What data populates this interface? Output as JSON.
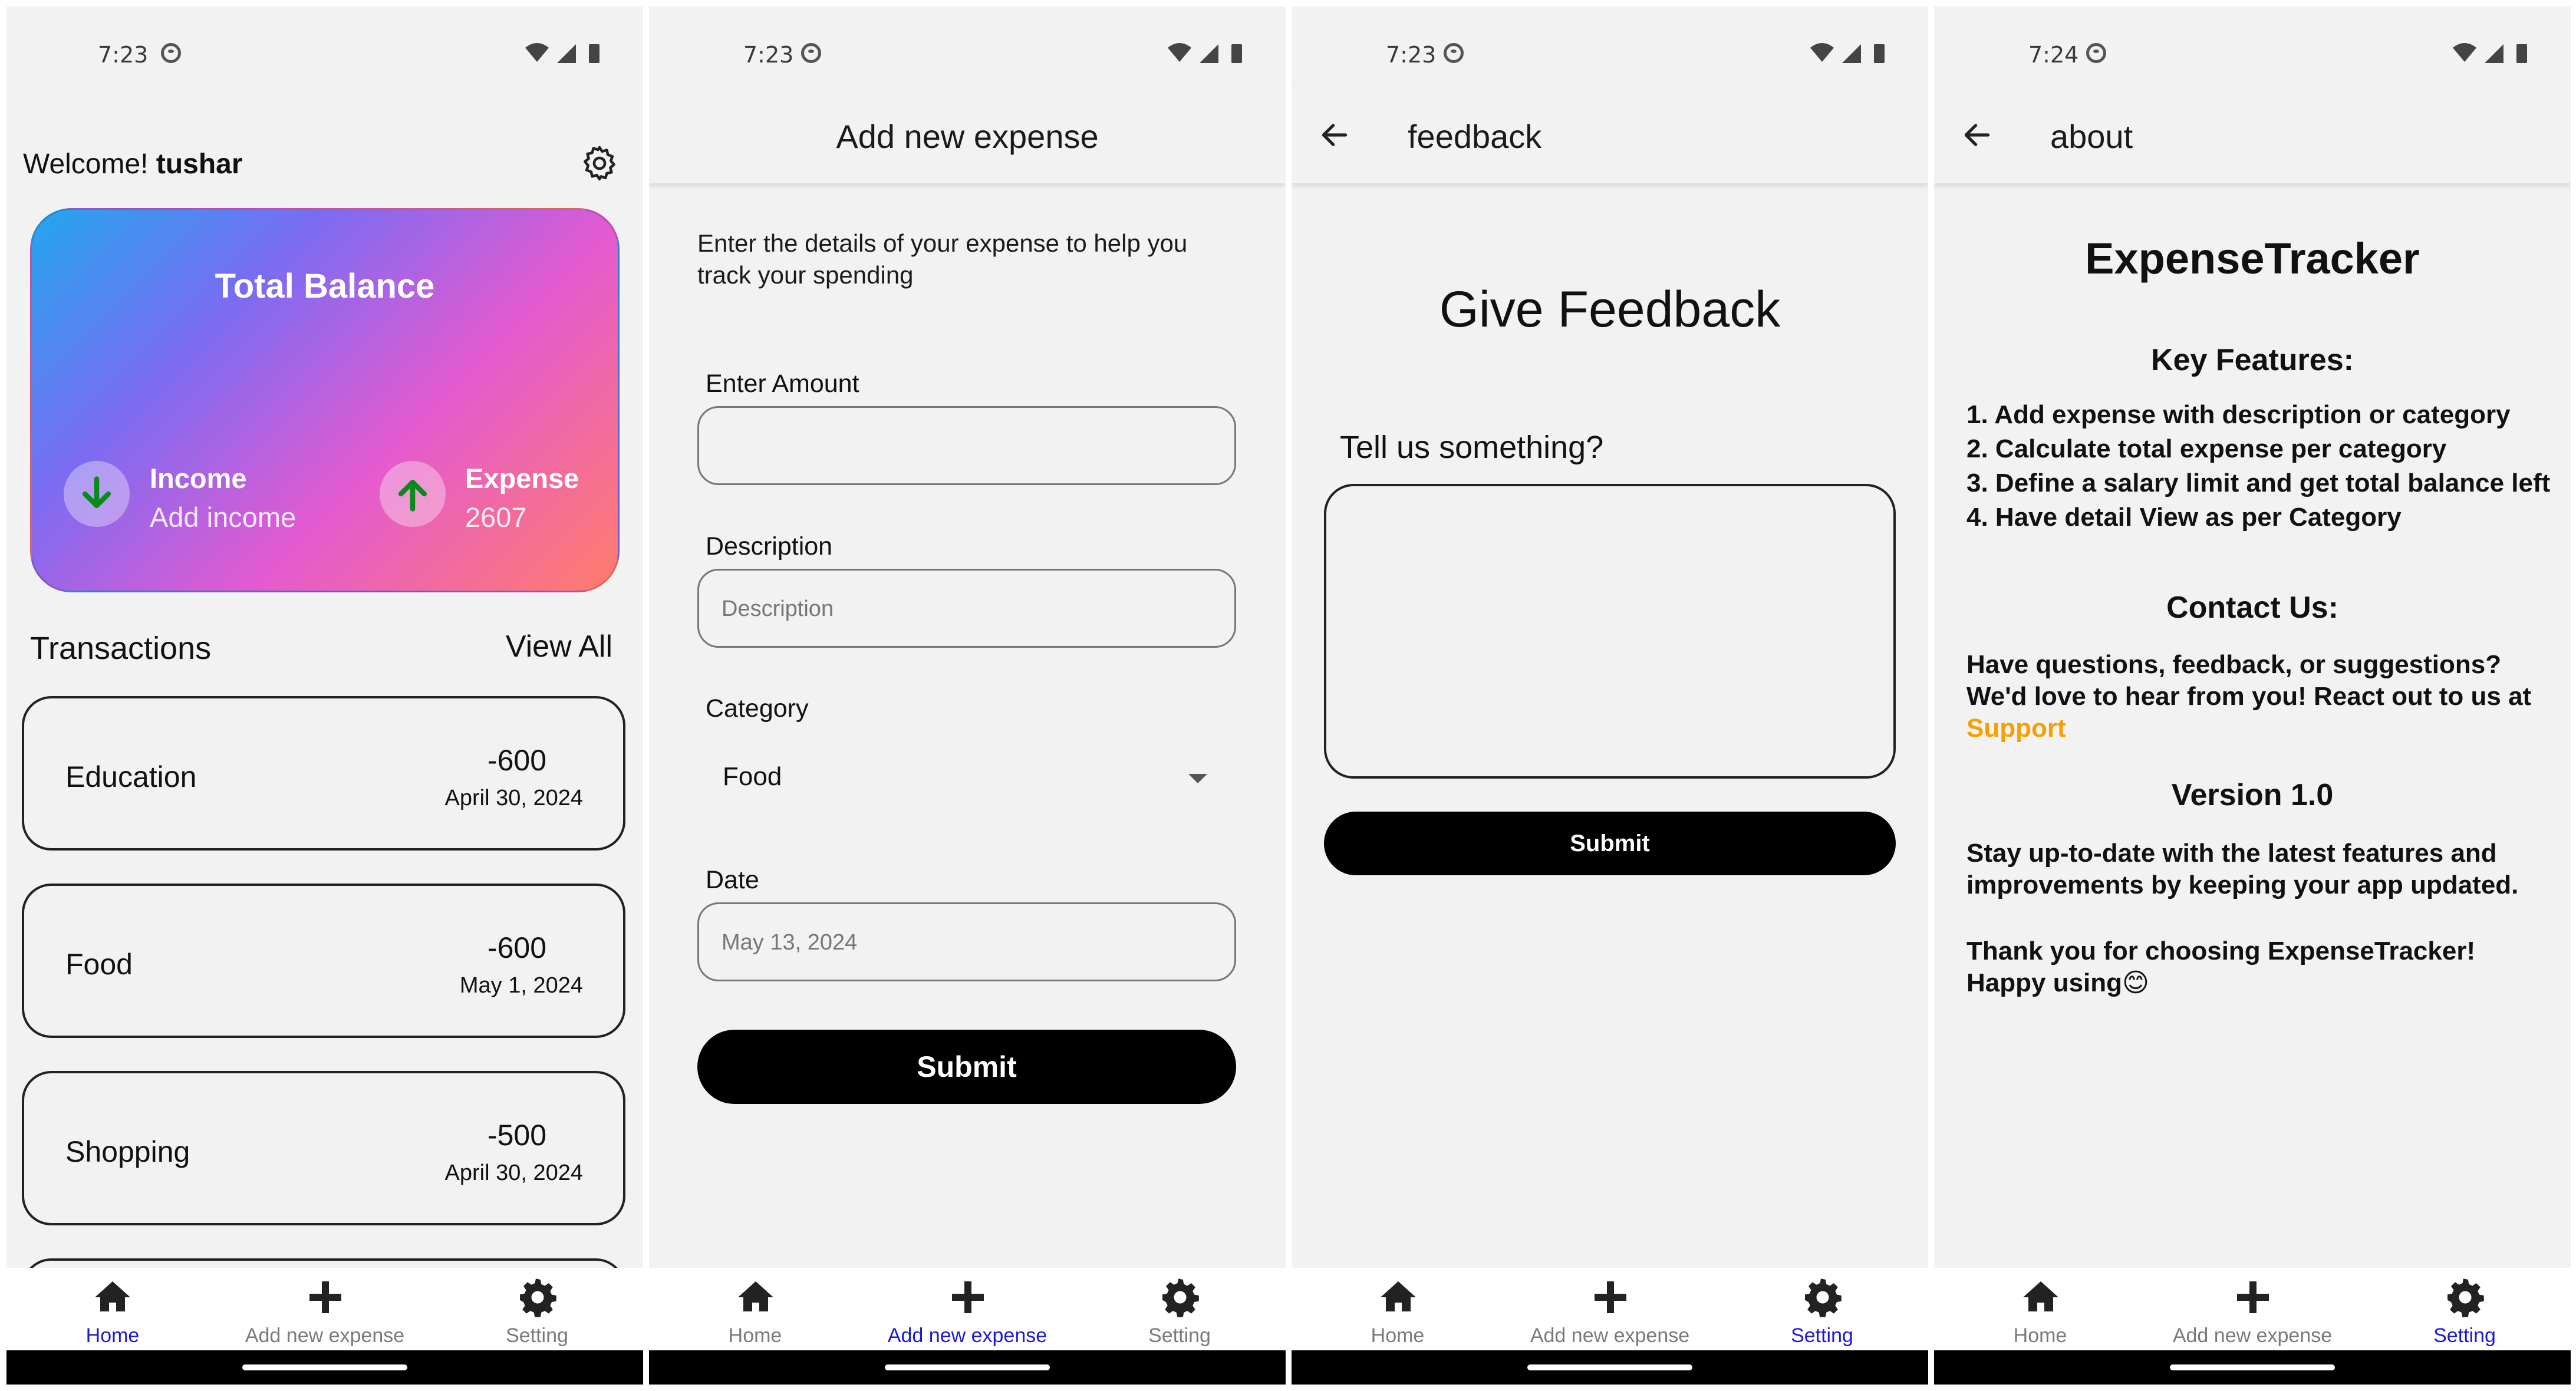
{
  "screens": {
    "home": {
      "time": "7:23",
      "welcome_prefix": "Welcome!",
      "username": "tushar",
      "balance_title": "Total Balance",
      "income_label": "Income",
      "income_value": "Add income",
      "expense_label": "Expense",
      "expense_value": "2607",
      "transactions_title": "Transactions",
      "view_all": "View All",
      "transactions": [
        {
          "name": "Education",
          "amount": "-600",
          "date": "April 30, 2024"
        },
        {
          "name": "Food",
          "amount": "-600",
          "date": "May 1, 2024"
        },
        {
          "name": "Shopping",
          "amount": "-500",
          "date": "April 30, 2024"
        }
      ],
      "active_tab": "Home"
    },
    "add_expense": {
      "time": "7:23",
      "title": "Add new expense",
      "intro": "Enter the details of your expense to help you track your spending",
      "amount_label": "Enter Amount",
      "amount_value": "",
      "description_label": "Description",
      "description_placeholder": "Description",
      "category_label": "Category",
      "category_value": "Food",
      "date_label": "Date",
      "date_value": "May 13, 2024",
      "submit": "Submit",
      "active_tab": "Add new expense"
    },
    "feedback": {
      "time": "7:23",
      "title": "feedback",
      "heading": "Give Feedback",
      "prompt": "Tell us something?",
      "submit": "Submit",
      "active_tab": "Setting"
    },
    "about": {
      "time": "7:24",
      "title": "about",
      "app_name": "ExpenseTracker",
      "features_title": "Key Features:",
      "features": [
        "1. Add expense with description or category",
        "2. Calculate total expense per category",
        "3. Define a salary limit and get total balance left",
        "4. Have detail View as per Category"
      ],
      "contact_title": "Contact Us:",
      "contact_text": "Have questions, feedback, or suggestions? We'd love to hear from you! React out to us at",
      "contact_link": "Support",
      "version_title": "Version 1.0",
      "version_text": "Stay up-to-date with the latest features and improvements by keeping your app updated.",
      "thanks_text": "Thank you for choosing ExpenseTracker! Happy using😊",
      "active_tab": "Setting"
    }
  },
  "nav": {
    "home": "Home",
    "add": "Add new expense",
    "setting": "Setting"
  },
  "colors": {
    "active_tab": "#1a1ad6",
    "inactive_tab": "#7a7a7a",
    "arrow_green": "#0a8a1a",
    "support_link": "#f5a000",
    "card_gradient": [
      "#22a7ef",
      "#7a6cf2",
      "#e45ad0",
      "#ff7d6a"
    ]
  }
}
